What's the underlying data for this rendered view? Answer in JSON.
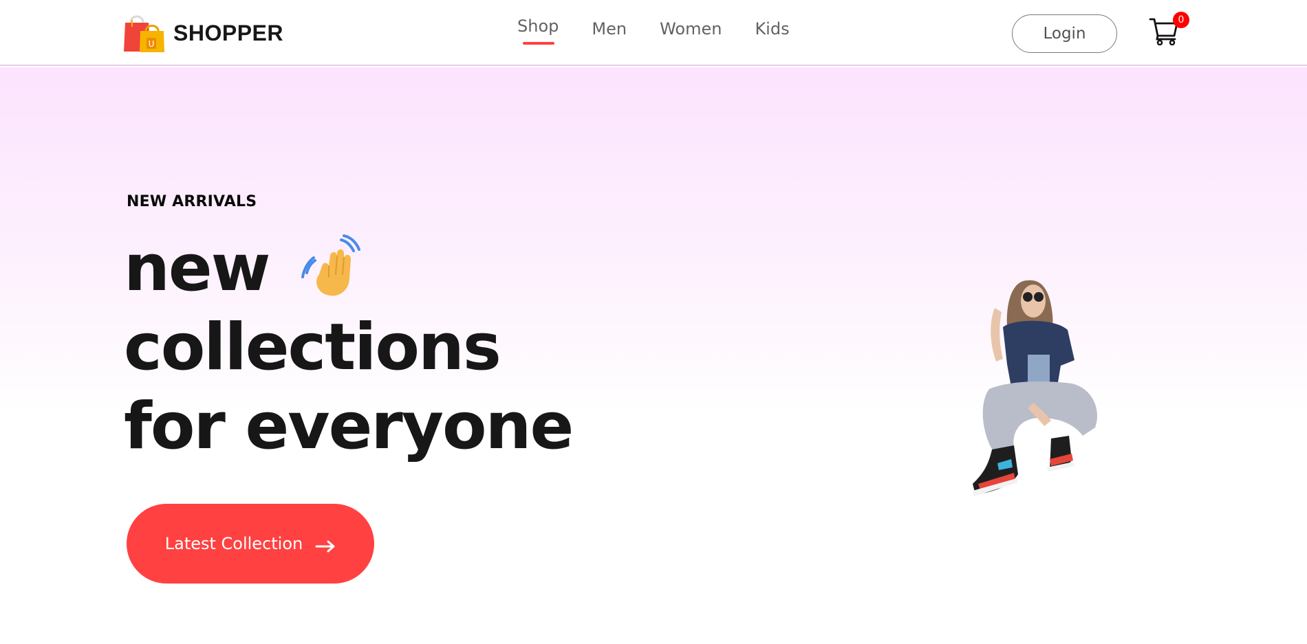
{
  "header": {
    "brand_name": "SHOPPER",
    "logo_icon": "shopping-bags-icon",
    "nav": [
      {
        "label": "Shop",
        "active": true
      },
      {
        "label": "Men",
        "active": false
      },
      {
        "label": "Women",
        "active": false
      },
      {
        "label": "Kids",
        "active": false
      }
    ],
    "login_label": "Login",
    "cart_icon": "cart-icon",
    "cart_count": "0",
    "colors": {
      "accent": "#ff4141",
      "badge": "#ff0000",
      "border": "#e6cde9"
    }
  },
  "hero": {
    "eyebrow": "NEW ARRIVALS",
    "headline_line_1": "new",
    "headline_line_2": "collections",
    "headline_line_3": "for everyone",
    "wave_icon": "waving-hand-icon",
    "cta_label": "Latest Collection",
    "cta_icon": "arrow-right-icon",
    "image_icon": "model-photo",
    "colors": {
      "gradient_top": "#fce3fe",
      "gradient_bottom": "#ffffff",
      "cta": "#ff4141",
      "headline": "#171717"
    }
  }
}
